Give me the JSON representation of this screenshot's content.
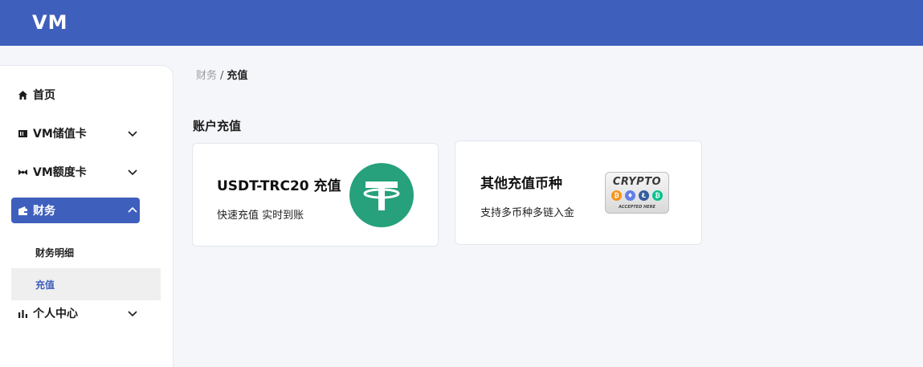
{
  "header": {
    "logo": "VM"
  },
  "sidebar": {
    "items": [
      {
        "label": "首页",
        "icon": "home-icon"
      },
      {
        "label": "VM储值卡",
        "icon": "card-icon"
      },
      {
        "label": "VM额度卡",
        "icon": "tie-icon"
      },
      {
        "label": "财务",
        "icon": "wallet-icon"
      },
      {
        "label": "个人中心",
        "icon": "bar-chart-icon"
      }
    ],
    "finance_sub": [
      {
        "label": "财务明细"
      },
      {
        "label": "充值"
      }
    ]
  },
  "breadcrumb": {
    "parent": "财务",
    "separator": "/",
    "current": "充值"
  },
  "section": {
    "title": "账户充值"
  },
  "cards": [
    {
      "title": "USDT-TRC20 充值",
      "desc": "快速充值 实时到账",
      "icon": "tether-icon"
    },
    {
      "title": "其他充值币种",
      "desc": "支持多币种多链入金",
      "icon": "crypto-badge-icon",
      "badge_text": "CRYPTO",
      "badge_caption": "ACCEPTED HERE"
    }
  ],
  "colors": {
    "brand": "#3f5fbd",
    "tether": "#26a17b",
    "background": "#f5f6fa"
  }
}
